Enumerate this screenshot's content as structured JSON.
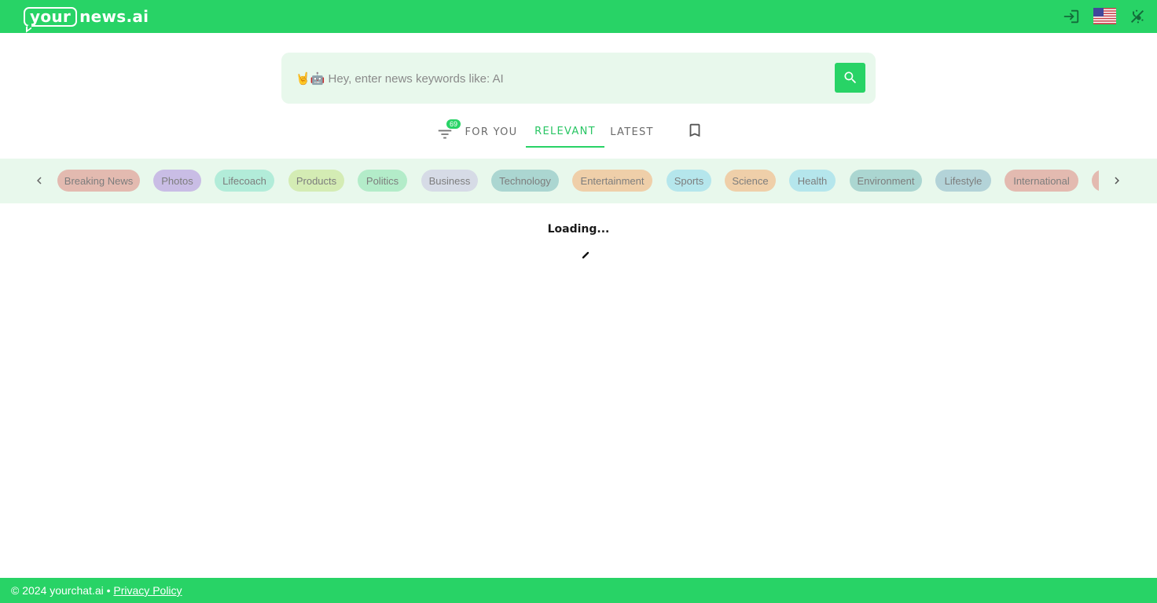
{
  "header": {
    "logo_bubble": "your",
    "logo_rest": "news.ai",
    "icons": [
      "login-icon",
      "us-flag-icon",
      "theme-toggle-icon"
    ]
  },
  "search": {
    "placeholder": "🤘🤖 Hey, enter news keywords like: AI",
    "value": "",
    "button_icon": "search-icon"
  },
  "tabs": {
    "filter_count": "69",
    "items": [
      {
        "label": "FOR YOU",
        "active": false
      },
      {
        "label": "RELEVANT",
        "active": true
      },
      {
        "label": "LATEST",
        "active": false
      }
    ],
    "bookmark_icon": "bookmark-icon"
  },
  "categories": [
    {
      "label": "Breaking News",
      "color": "#e3bab0"
    },
    {
      "label": "Photos",
      "color": "#c9bde5"
    },
    {
      "label": "Lifecoach",
      "color": "#b2ecd9"
    },
    {
      "label": "Products",
      "color": "#d4ecb4"
    },
    {
      "label": "Politics",
      "color": "#b3ecc9"
    },
    {
      "label": "Business",
      "color": "#d6dbe6"
    },
    {
      "label": "Technology",
      "color": "#abd6d1"
    },
    {
      "label": "Entertainment",
      "color": "#efcfa9"
    },
    {
      "label": "Sports",
      "color": "#b5e6ec"
    },
    {
      "label": "Science",
      "color": "#efcfa9"
    },
    {
      "label": "Health",
      "color": "#b5e6ec"
    },
    {
      "label": "Environment",
      "color": "#abd6d1"
    },
    {
      "label": "Lifestyle",
      "color": "#b3d3d8"
    },
    {
      "label": "International",
      "color": "#e3bab0"
    },
    {
      "label": "",
      "color": "#e3bab0"
    }
  ],
  "main": {
    "loading_text": "Loading..."
  },
  "footer": {
    "copyright": "© 2024 yourchat.ai • ",
    "privacy_link": "Privacy Policy"
  },
  "colors": {
    "brand": "#28d366",
    "active_tab": "#28c563",
    "search_bg": "#e8f8ec"
  }
}
